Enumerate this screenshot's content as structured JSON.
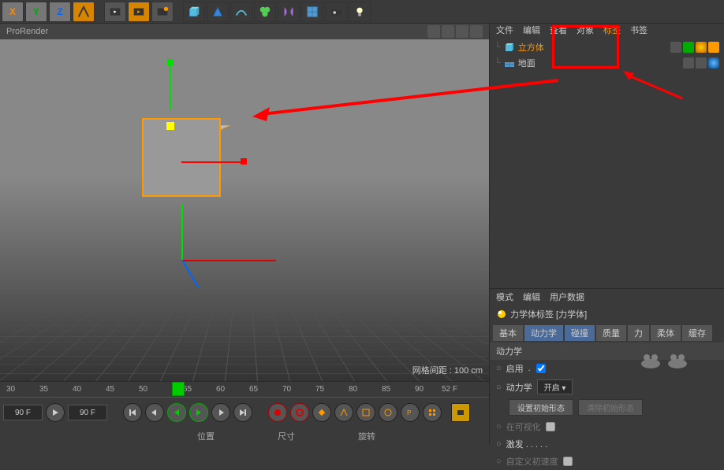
{
  "toolbar": {
    "axis_x": "X",
    "axis_y": "Y",
    "axis_z": "Z"
  },
  "viewport": {
    "renderer": "ProRender",
    "grid_info": "网格间距 : 100 cm"
  },
  "timeline": {
    "ticks": [
      "30",
      "35",
      "40",
      "45",
      "50",
      "52 55",
      "60",
      "65",
      "70",
      "75",
      "80",
      "85",
      "90"
    ],
    "frame_end_display": "52 F",
    "cur_frame": "90 F",
    "goto_frame": "90 F"
  },
  "bottom": {
    "position": "位置",
    "size": "尺寸",
    "rotation": "旋转"
  },
  "obj_panel": {
    "menu_file": "文件",
    "menu_edit": "编辑",
    "menu_view": "查看",
    "menu_obj": "对象",
    "menu_tags": "标签",
    "menu_bookmark": "书签",
    "cube": "立方体",
    "floor": "地面"
  },
  "attr_panel": {
    "menu_mode": "模式",
    "menu_edit": "编辑",
    "menu_userdata": "用户数据",
    "title": "力学体标签 [力学体]",
    "tab_basic": "基本",
    "tab_dynamics": "动力学",
    "tab_collision": "碰撞",
    "tab_mass": "质量",
    "tab_force": "力",
    "tab_soft": "柔体",
    "tab_cache": "缓存",
    "section": "动力学",
    "enable": "启用",
    "dynamics": "动力学",
    "dynamics_val": "开启",
    "set_initial": "设置初始形态",
    "clear_initial": "清除初始形态",
    "visible_only": "在可视化",
    "trigger": "激发 . . . . .",
    "custom_speed": "自定义初速度"
  }
}
